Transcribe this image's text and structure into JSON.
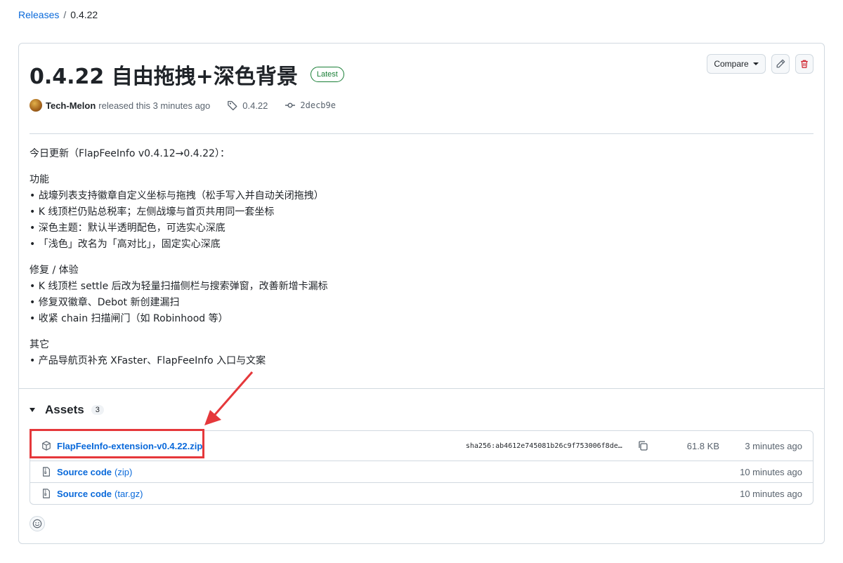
{
  "breadcrumb": {
    "releases": "Releases",
    "separator": "/",
    "current": "0.4.22"
  },
  "release": {
    "title": "0.4.22 自由拖拽+深色背景",
    "badge": "Latest",
    "author": "Tech-Melon",
    "released_text": "released this 3 minutes ago",
    "tag": "0.4.22",
    "commit": "2decb9e"
  },
  "actions": {
    "compare_label": "Compare"
  },
  "notes": {
    "intro": "今日更新（FlapFeeInfo v0.4.12→0.4.22）：",
    "sections": [
      {
        "heading": "功能",
        "items": [
          "• 战壕列表支持徽章自定义坐标与拖拽（松手写入并自动关闭拖拽）",
          "• K 线顶栏仍贴总税率；左侧战壕与首页共用同一套坐标",
          "• 深色主题：默认半透明配色，可选实心深底",
          "• 「浅色」改名为「高对比」，固定实心深底"
        ]
      },
      {
        "heading": "修复 / 体验",
        "items": [
          "• K 线顶栏 settle 后改为轻量扫描侧栏与搜索弹窗，改善新增卡漏标",
          "• 修复双徽章、Debot 新创建漏扫",
          "• 收紧 chain 扫描闸门（如 Robinhood 等）"
        ]
      },
      {
        "heading": "其它",
        "items": [
          "• 产品导航页补充 XFaster、FlapFeeInfo 入口与文案"
        ]
      }
    ]
  },
  "assets": {
    "title": "Assets",
    "count": "3",
    "files": [
      {
        "name": "FlapFeeInfo-extension-v0.4.22.zip",
        "sha": "sha256:ab4612e745081b26c9f753006f8de…",
        "size": "61.8 KB",
        "time": "3 minutes ago"
      },
      {
        "name": "Source code",
        "ext": "(zip)",
        "time": "10 minutes ago"
      },
      {
        "name": "Source code",
        "ext": "(tar.gz)",
        "time": "10 minutes ago"
      }
    ]
  },
  "colors": {
    "link": "#0969da",
    "latest": "#1a7f37",
    "delete": "#cf222e",
    "highlight": "#e5383b"
  }
}
